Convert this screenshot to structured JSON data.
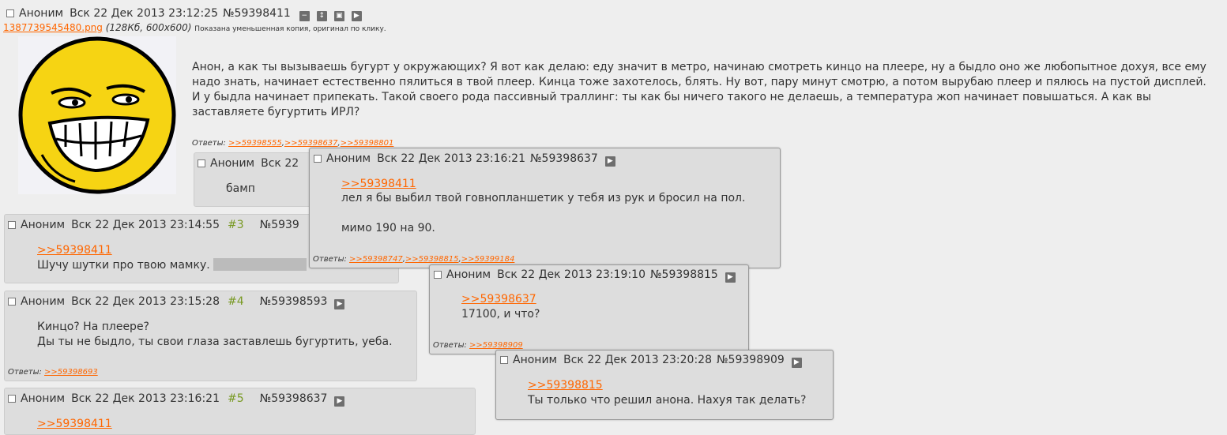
{
  "op": {
    "author": "Аноним",
    "date": "Вск 22 Дек 2013 23:12:25",
    "number": "№59398411",
    "file_name": "1387739545480.png",
    "file_info": "(128Кб, 600x600)",
    "file_note": "Показана уменьшенная копия, оригинал по клику.",
    "text": "Анон, а как ты вызываешь бугурт у окружающих? Я вот как делаю: еду значит в метро, начинаю смотреть кинцо на плеере, ну а быдло оно же любопытное дохуя, все ему надо знать, начинает естественно пялиться в твой плеер. Кинца тоже захотелось, блять. Ну вот, пару минут смотрю, а потом вырубаю плеер и пялюсь на пустой дисплей. И у быдла начинает припекать. Такой своего рода пассивный траллинг: ты как бы ничего такого не делаешь, а температура жоп начинает повышаться. А как вы заставляете бугуртить ИРЛ?",
    "replies_label": "Ответы:",
    "replies": [
      ">>59398555",
      ">>59398637",
      ">>59398801"
    ]
  },
  "posts": [
    {
      "author": "Аноним",
      "date_partial": "Вск 22",
      "text": "бамп"
    },
    {
      "author": "Аноним",
      "date": "Вск 22 Дек 2013 23:14:55",
      "ordinal": "#3",
      "number_partial": "№5939",
      "quote": ">>59398411",
      "text": "Шучу шутки про твою мамку."
    },
    {
      "author": "Аноним",
      "date": "Вск 22 Дек 2013 23:15:28",
      "ordinal": "#4",
      "number": "№59398593",
      "line1": "Кинцо? На плеере?",
      "line2": "Ды ты не быдло, ты свои глаза заставлешь бугуртить, уеба.",
      "replies_label": "Ответы:",
      "replies": [
        ">>59398693"
      ]
    },
    {
      "author": "Аноним",
      "date": "Вск 22 Дек 2013 23:16:21",
      "ordinal": "#5",
      "number": "№59398637",
      "quote_partial": ">>59398411"
    }
  ],
  "popups": [
    {
      "author": "Аноним",
      "date": "Вск 22 Дек 2013 23:16:21",
      "number": "№59398637",
      "quote": ">>59398411",
      "line1": "лел я бы выбил твой говнопланшетик у тебя из рук и бросил на пол.",
      "line2": "мимо 190 на 90.",
      "replies_label": "Ответы:",
      "replies": [
        ">>59398747",
        ">>59398815",
        ">>59399184"
      ]
    },
    {
      "author": "Аноним",
      "date": "Вск 22 Дек 2013 23:19:10",
      "number": "№59398815",
      "quote": ">>59398637",
      "text": "17100, и что?",
      "replies_label": "Ответы:",
      "replies": [
        ">>59398909"
      ]
    },
    {
      "author": "Аноним",
      "date": "Вск 22 Дек 2013 23:20:28",
      "number": "№59398909",
      "quote": ">>59398815",
      "text": "Ты только что решил анона. Нахуя так делать?"
    }
  ],
  "icons": [
    "minus-icon",
    "expand-icon",
    "window-icon",
    "play-icon"
  ],
  "colors": {
    "background": "#eeeeee",
    "post": "#dddddd",
    "link": "#ff6600",
    "ordinal": "#789922"
  }
}
